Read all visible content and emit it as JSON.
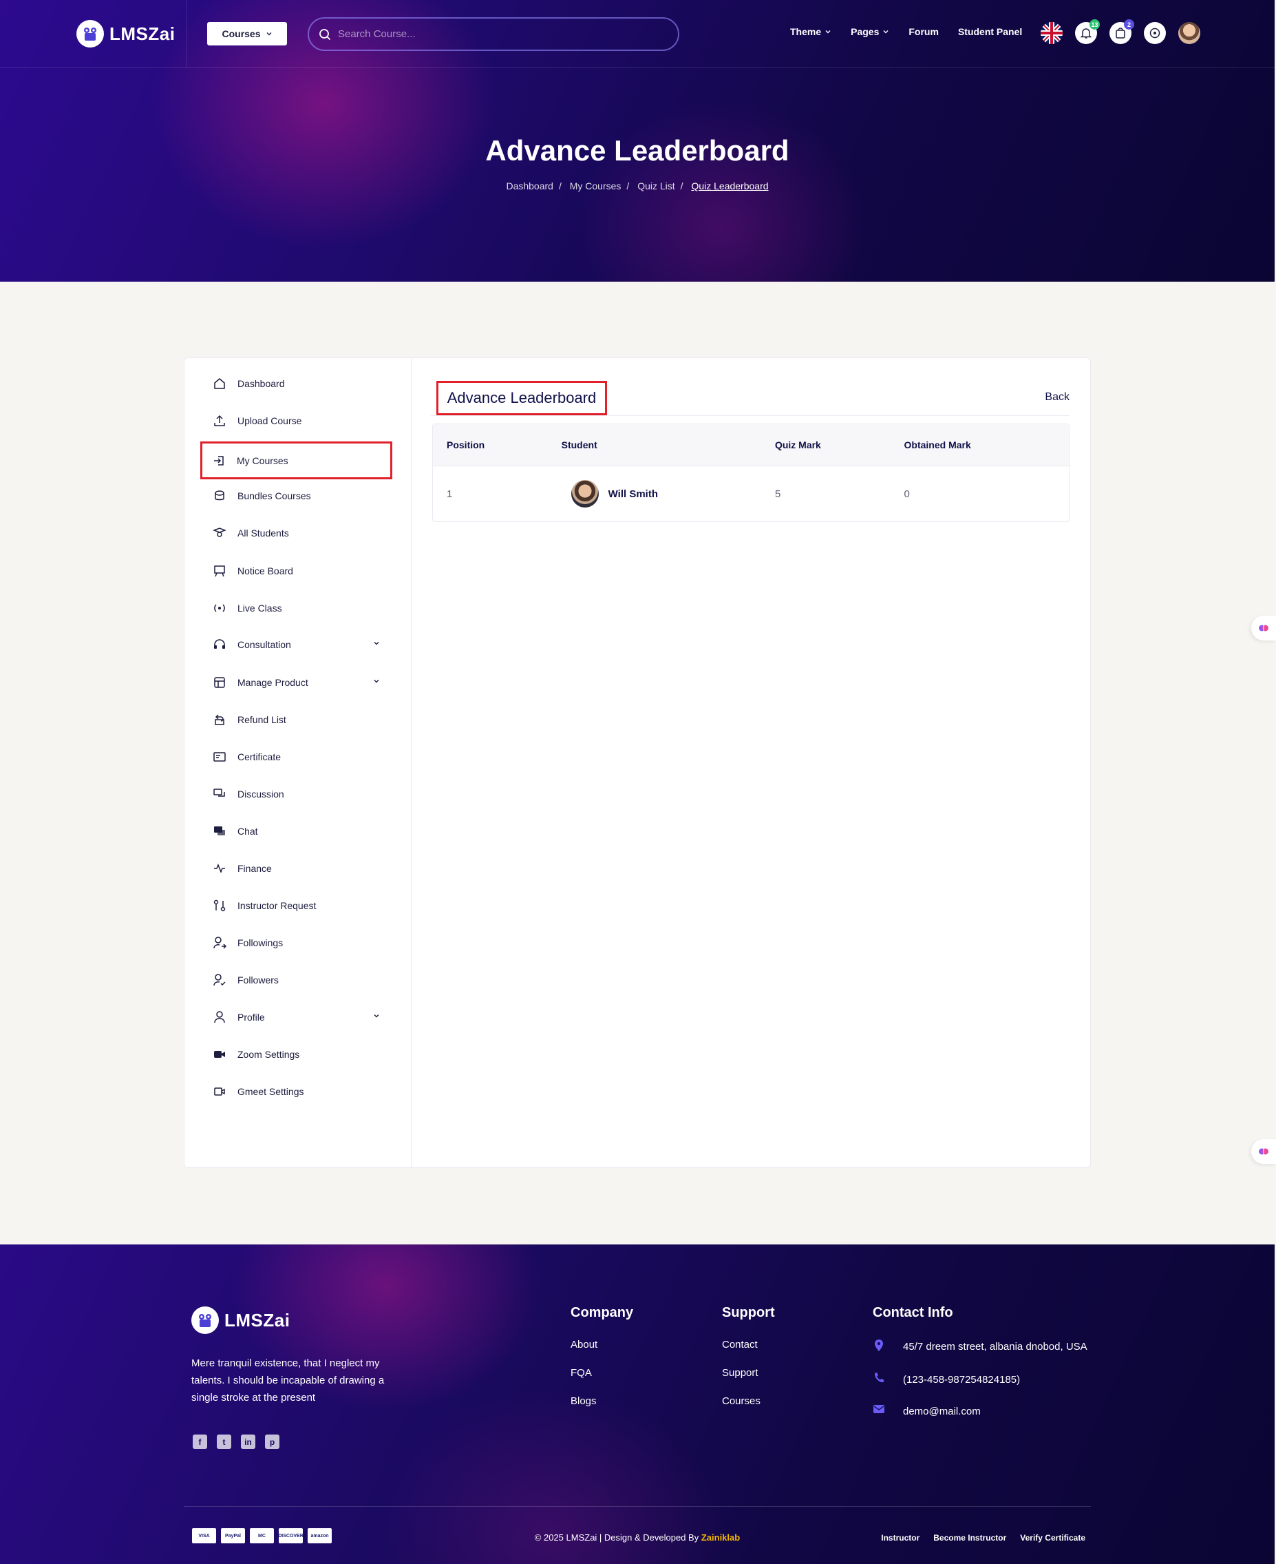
{
  "brand": {
    "name": "LMSZai"
  },
  "header": {
    "courses_label": "Courses",
    "search_placeholder": "Search Course...",
    "nav": [
      "Theme",
      "Pages",
      "Forum",
      "Student Panel"
    ],
    "notification_count": "13",
    "cart_count": "2"
  },
  "hero": {
    "title": "Advance Leaderboard",
    "breadcrumb": [
      "Dashboard",
      "My Courses",
      "Quiz List",
      "Quiz Leaderboard"
    ]
  },
  "sidebar": {
    "items": [
      {
        "label": "Dashboard",
        "icon": "home-icon"
      },
      {
        "label": "Upload Course",
        "icon": "upload-icon"
      },
      {
        "label": "My Courses",
        "icon": "login-icon",
        "active": true
      },
      {
        "label": "Bundles Courses",
        "icon": "bundle-icon"
      },
      {
        "label": "All Students",
        "icon": "students-icon"
      },
      {
        "label": "Notice Board",
        "icon": "board-icon"
      },
      {
        "label": "Live Class",
        "icon": "broadcast-icon"
      },
      {
        "label": "Consultation",
        "icon": "headset-icon",
        "expandable": true
      },
      {
        "label": "Manage Product",
        "icon": "store-icon",
        "expandable": true
      },
      {
        "label": "Refund List",
        "icon": "refund-icon"
      },
      {
        "label": "Certificate",
        "icon": "certificate-icon"
      },
      {
        "label": "Discussion",
        "icon": "discussion-icon"
      },
      {
        "label": "Chat",
        "icon": "chat-icon"
      },
      {
        "label": "Finance",
        "icon": "pulse-icon"
      },
      {
        "label": "Instructor Request",
        "icon": "request-icon"
      },
      {
        "label": "Followings",
        "icon": "user-arrow-icon"
      },
      {
        "label": "Followers",
        "icon": "user-check-icon"
      },
      {
        "label": "Profile",
        "icon": "user-icon",
        "expandable": true
      },
      {
        "label": "Zoom Settings",
        "icon": "video-icon"
      },
      {
        "label": "Gmeet Settings",
        "icon": "gmeet-icon"
      }
    ]
  },
  "main": {
    "title": "Advance Leaderboard",
    "back_label": "Back",
    "table": {
      "headers": [
        "Position",
        "Student",
        "Quiz Mark",
        "Obtained Mark"
      ],
      "rows": [
        {
          "position": "1",
          "student": "Will Smith",
          "quiz_mark": "5",
          "obtained_mark": "0"
        }
      ]
    }
  },
  "footer": {
    "description": "Mere tranquil existence, that I neglect my talents. I should be incapable of drawing a single stroke at the present",
    "company": {
      "title": "Company",
      "links": [
        "About",
        "FQA",
        "Blogs"
      ]
    },
    "support": {
      "title": "Support",
      "links": [
        "Contact",
        "Support",
        "Courses"
      ]
    },
    "contact": {
      "title": "Contact Info",
      "address": "45/7 dreem street, albania dnobod, USA",
      "phone": "(123-458-987254824185)",
      "email": "demo@mail.com"
    },
    "payments": [
      "VISA",
      "PayPal",
      "MC",
      "DISCOVER",
      "amazon"
    ],
    "copyright_prefix": "© 2025 LMSZai | Design & Developed By",
    "copyright_brand": "Zainiklab",
    "bottom_links": [
      "Instructor",
      "Become Instructor",
      "Verify Certificate"
    ]
  },
  "colors": {
    "accent": "#5b4fe3",
    "highlight": "#e1202a",
    "text_dark": "#12124a"
  }
}
